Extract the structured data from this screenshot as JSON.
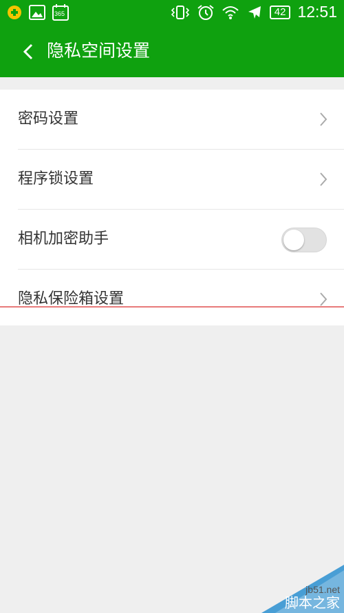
{
  "status_bar": {
    "left_icons": [
      "app-notification-icon",
      "image-icon",
      "calendar-365-icon"
    ],
    "calendar_text": "365",
    "right_icons": [
      "vibrate-icon",
      "alarm-icon",
      "wifi-icon",
      "airplane-icon"
    ],
    "battery": "42",
    "time": "12:51"
  },
  "app_bar": {
    "title": "隐私空间设置",
    "back_icon": "back-chevron-icon",
    "color": "#0fa10f"
  },
  "settings": {
    "items": [
      {
        "label": "密码设置",
        "control": "chevron"
      },
      {
        "label": "程序锁设置",
        "control": "chevron"
      },
      {
        "label": "相机加密助手",
        "control": "toggle",
        "toggle_on": false
      },
      {
        "label": "隐私保险箱设置",
        "control": "chevron"
      }
    ]
  },
  "watermark": {
    "site": "jb51.net",
    "name": "脚本之家"
  }
}
